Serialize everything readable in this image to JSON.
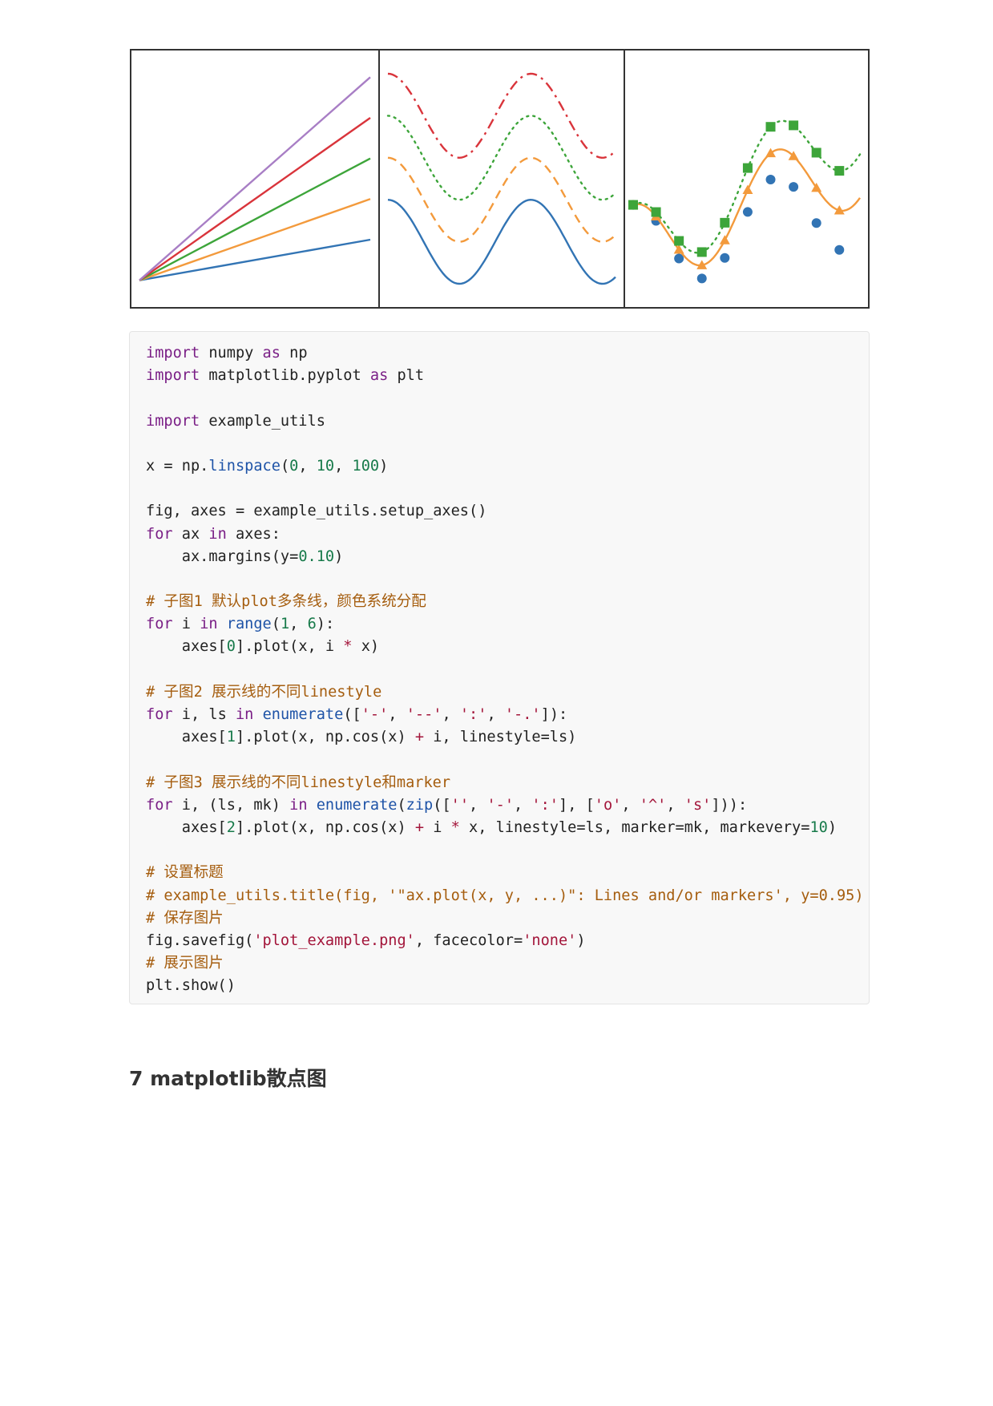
{
  "colors": {
    "blue": "#3274b4",
    "orange": "#f39a3c",
    "green": "#3da53a",
    "red": "#d9343b",
    "purple": "#a87ec5",
    "border": "#333333"
  },
  "chart_data": [
    {
      "type": "line",
      "lines": [
        {
          "x": [
            0,
            10
          ],
          "y": [
            0,
            10
          ]
        },
        {
          "x": [
            0,
            10
          ],
          "y": [
            0,
            20
          ]
        },
        {
          "x": [
            0,
            10
          ],
          "y": [
            0,
            30
          ]
        },
        {
          "x": [
            0,
            10
          ],
          "y": [
            0,
            40
          ]
        },
        {
          "x": [
            0,
            10
          ],
          "y": [
            0,
            50
          ]
        }
      ],
      "xlim": [
        0,
        10
      ],
      "ylim": [
        -5,
        55
      ],
      "grid": false,
      "colors": [
        "#3274b4",
        "#f39a3c",
        "#3da53a",
        "#d9343b",
        "#a87ec5"
      ]
    },
    {
      "type": "line",
      "lines": [
        {
          "offset": 0,
          "linestyle": "solid"
        },
        {
          "offset": 1,
          "linestyle": "dashed"
        },
        {
          "offset": 2,
          "linestyle": "dotted"
        },
        {
          "offset": 3,
          "linestyle": "dashdot"
        }
      ],
      "function": "cos(x) + offset",
      "xlim": [
        0,
        10
      ],
      "ylim": [
        -1.4,
        4.4
      ],
      "grid": false,
      "colors": [
        "#3274b4",
        "#f39a3c",
        "#3da53a",
        "#d9343b"
      ]
    },
    {
      "type": "line",
      "lines": [
        {
          "scale": 0.1,
          "linestyle": "none",
          "marker": "circle"
        },
        {
          "scale": 0.2,
          "linestyle": "solid",
          "marker": "triangle"
        },
        {
          "scale": 0.3,
          "linestyle": "dotted",
          "marker": "square"
        }
      ],
      "function": "cos(x) + scale * x",
      "markevery": 10,
      "xlim": [
        0,
        10
      ],
      "ylim": [
        -1.2,
        4.4
      ],
      "grid": false,
      "colors": [
        "#3274b4",
        "#f39a3c",
        "#3da53a"
      ]
    }
  ],
  "code": {
    "lines": [
      [
        [
          "kw",
          "import"
        ],
        [
          "p",
          " numpy "
        ],
        [
          "kw",
          "as"
        ],
        [
          "p",
          " np"
        ]
      ],
      [
        [
          "kw",
          "import"
        ],
        [
          "p",
          " matplotlib.pyplot "
        ],
        [
          "kw",
          "as"
        ],
        [
          "p",
          " plt"
        ]
      ],
      [],
      [
        [
          "kw",
          "import"
        ],
        [
          "p",
          " example_utils"
        ]
      ],
      [],
      [
        [
          "p",
          "x = np."
        ],
        [
          "fn",
          "linspace"
        ],
        [
          "p",
          "("
        ],
        [
          "num",
          "0"
        ],
        [
          "p",
          ", "
        ],
        [
          "num",
          "10"
        ],
        [
          "p",
          ", "
        ],
        [
          "num",
          "100"
        ],
        [
          "p",
          ")"
        ]
      ],
      [],
      [
        [
          "p",
          "fig, axes = example_utils.setup_axes()"
        ]
      ],
      [
        [
          "kw",
          "for"
        ],
        [
          "p",
          " ax "
        ],
        [
          "kw",
          "in"
        ],
        [
          "p",
          " axes:"
        ]
      ],
      [
        [
          "p",
          "    ax.margins(y="
        ],
        [
          "num",
          "0.10"
        ],
        [
          "p",
          ")"
        ]
      ],
      [],
      [
        [
          "cm",
          "# 子图1 默认plot多条线，颜色系统分配"
        ]
      ],
      [
        [
          "kw",
          "for"
        ],
        [
          "p",
          " i "
        ],
        [
          "kw",
          "in"
        ],
        [
          "p",
          " "
        ],
        [
          "fn",
          "range"
        ],
        [
          "p",
          "("
        ],
        [
          "num",
          "1"
        ],
        [
          "p",
          ", "
        ],
        [
          "num",
          "6"
        ],
        [
          "p",
          "):"
        ]
      ],
      [
        [
          "p",
          "    axes["
        ],
        [
          "num",
          "0"
        ],
        [
          "p",
          "].plot(x, i "
        ],
        [
          "op",
          "*"
        ],
        [
          "p",
          " x)"
        ]
      ],
      [],
      [
        [
          "cm",
          "# 子图2 展示线的不同linestyle"
        ]
      ],
      [
        [
          "kw",
          "for"
        ],
        [
          "p",
          " i, ls "
        ],
        [
          "kw",
          "in"
        ],
        [
          "p",
          " "
        ],
        [
          "fn",
          "enumerate"
        ],
        [
          "p",
          "(["
        ],
        [
          "str",
          "'-'"
        ],
        [
          "p",
          ", "
        ],
        [
          "str",
          "'--'"
        ],
        [
          "p",
          ", "
        ],
        [
          "str",
          "':'"
        ],
        [
          "p",
          ", "
        ],
        [
          "str",
          "'-.'"
        ],
        [
          "p",
          "]):"
        ]
      ],
      [
        [
          "p",
          "    axes["
        ],
        [
          "num",
          "1"
        ],
        [
          "p",
          "].plot(x, np.cos(x) "
        ],
        [
          "op",
          "+"
        ],
        [
          "p",
          " i, linestyle=ls)"
        ]
      ],
      [],
      [
        [
          "cm",
          "# 子图3 展示线的不同linestyle和marker"
        ]
      ],
      [
        [
          "kw",
          "for"
        ],
        [
          "p",
          " i, (ls, mk) "
        ],
        [
          "kw",
          "in"
        ],
        [
          "p",
          " "
        ],
        [
          "fn",
          "enumerate"
        ],
        [
          "p",
          "("
        ],
        [
          "fn",
          "zip"
        ],
        [
          "p",
          "(["
        ],
        [
          "str",
          "''"
        ],
        [
          "p",
          ", "
        ],
        [
          "str",
          "'-'"
        ],
        [
          "p",
          ", "
        ],
        [
          "str",
          "':'"
        ],
        [
          "p",
          "], ["
        ],
        [
          "str",
          "'o'"
        ],
        [
          "p",
          ", "
        ],
        [
          "str",
          "'^'"
        ],
        [
          "p",
          ", "
        ],
        [
          "str",
          "'s'"
        ],
        [
          "p",
          "])):"
        ]
      ],
      [
        [
          "p",
          "    axes["
        ],
        [
          "num",
          "2"
        ],
        [
          "p",
          "].plot(x, np.cos(x) "
        ],
        [
          "op",
          "+"
        ],
        [
          "p",
          " i "
        ],
        [
          "op",
          "*"
        ],
        [
          "p",
          " x, linestyle=ls, marker=mk, markevery="
        ],
        [
          "num",
          "10"
        ],
        [
          "p",
          ")"
        ]
      ],
      [],
      [
        [
          "cm",
          "# 设置标题"
        ]
      ],
      [
        [
          "cm",
          "# example_utils.title(fig, '\"ax.plot(x, y, ...)\": Lines and/or markers', y=0.95)"
        ]
      ],
      [
        [
          "cm",
          "# 保存图片"
        ]
      ],
      [
        [
          "p",
          "fig.savefig("
        ],
        [
          "str",
          "'plot_example.png'"
        ],
        [
          "p",
          ", facecolor="
        ],
        [
          "str",
          "'none'"
        ],
        [
          "p",
          ")"
        ]
      ],
      [
        [
          "cm",
          "# 展示图片"
        ]
      ],
      [
        [
          "p",
          "plt.show()"
        ]
      ]
    ]
  },
  "section_heading": "7 matplotlib散点图"
}
